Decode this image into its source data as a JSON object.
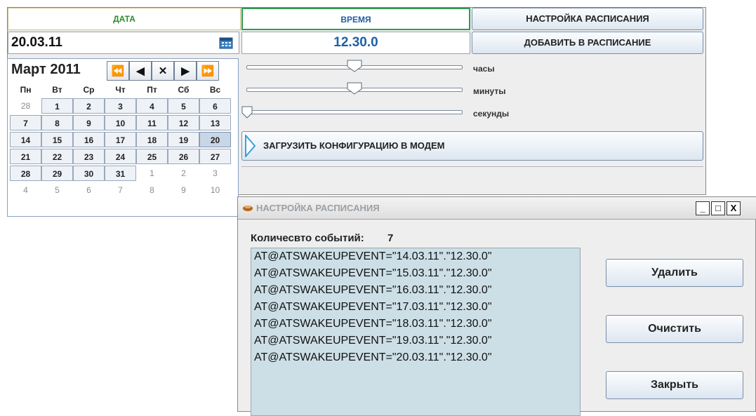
{
  "header": {
    "date_label": "ДАТА",
    "time_label": "ВРЕМЯ",
    "schedule_settings_label": "НАСТРОЙКА РАСПИСАНИЯ"
  },
  "date_field": {
    "value": "20.03.11"
  },
  "time_field": {
    "value": "12.30.0"
  },
  "add_to_schedule_label": "ДОБАВИТЬ  В РАСПИСАНИЕ",
  "calendar": {
    "month_year": "Март 2011",
    "nav": {
      "first": "⏪",
      "prev": "◀",
      "close": "✕",
      "next": "▶",
      "last": "⏩"
    },
    "weekdays": [
      "Пн",
      "Вт",
      "Ср",
      "Чт",
      "Пт",
      "Сб",
      "Вс"
    ],
    "rows": [
      [
        "28",
        "1",
        "2",
        "3",
        "4",
        "5",
        "6"
      ],
      [
        "7",
        "8",
        "9",
        "10",
        "11",
        "12",
        "13"
      ],
      [
        "14",
        "15",
        "16",
        "17",
        "18",
        "19",
        "20"
      ],
      [
        "21",
        "22",
        "23",
        "24",
        "25",
        "26",
        "27"
      ],
      [
        "28",
        "29",
        "30",
        "31",
        "1",
        "2",
        "3"
      ],
      [
        "4",
        "5",
        "6",
        "7",
        "8",
        "9",
        "10"
      ]
    ]
  },
  "sliders": {
    "hours": {
      "label": "часы",
      "level": 0.5
    },
    "minutes": {
      "label": "минуты",
      "level": 0.5
    },
    "seconds": {
      "label": "секунды",
      "level": 0.0
    }
  },
  "load_config_label": "ЗАГРУЗИТЬ КОНФИГУРАЦИЮ В МОДЕМ",
  "dialog": {
    "title": "НАСТРОЙКА РАСПИСАНИЯ",
    "event_count_label": "Количесвто событий:",
    "event_count": "7",
    "events": [
      "AT@ATSWAKEUPEVENT=\"14.03.11\".\"12.30.0\"",
      "AT@ATSWAKEUPEVENT=\"15.03.11\".\"12.30.0\"",
      "AT@ATSWAKEUPEVENT=\"16.03.11\".\"12.30.0\"",
      "AT@ATSWAKEUPEVENT=\"17.03.11\".\"12.30.0\"",
      "AT@ATSWAKEUPEVENT=\"18.03.11\".\"12.30.0\"",
      "AT@ATSWAKEUPEVENT=\"19.03.11\".\"12.30.0\"",
      "AT@ATSWAKEUPEVENT=\"20.03.11\".\"12.30.0\""
    ],
    "delete_label": "Удалить",
    "clear_label": "Очистить",
    "close_label": "Закрыть",
    "window_buttons": {
      "minimize": "_",
      "maximize": "□",
      "close": "X"
    }
  },
  "colors": {
    "date_header": "#2e8b2e",
    "time_header": "#1f5fa8",
    "time_value": "#1f5fa8",
    "list_bg": "#cddfe6"
  }
}
